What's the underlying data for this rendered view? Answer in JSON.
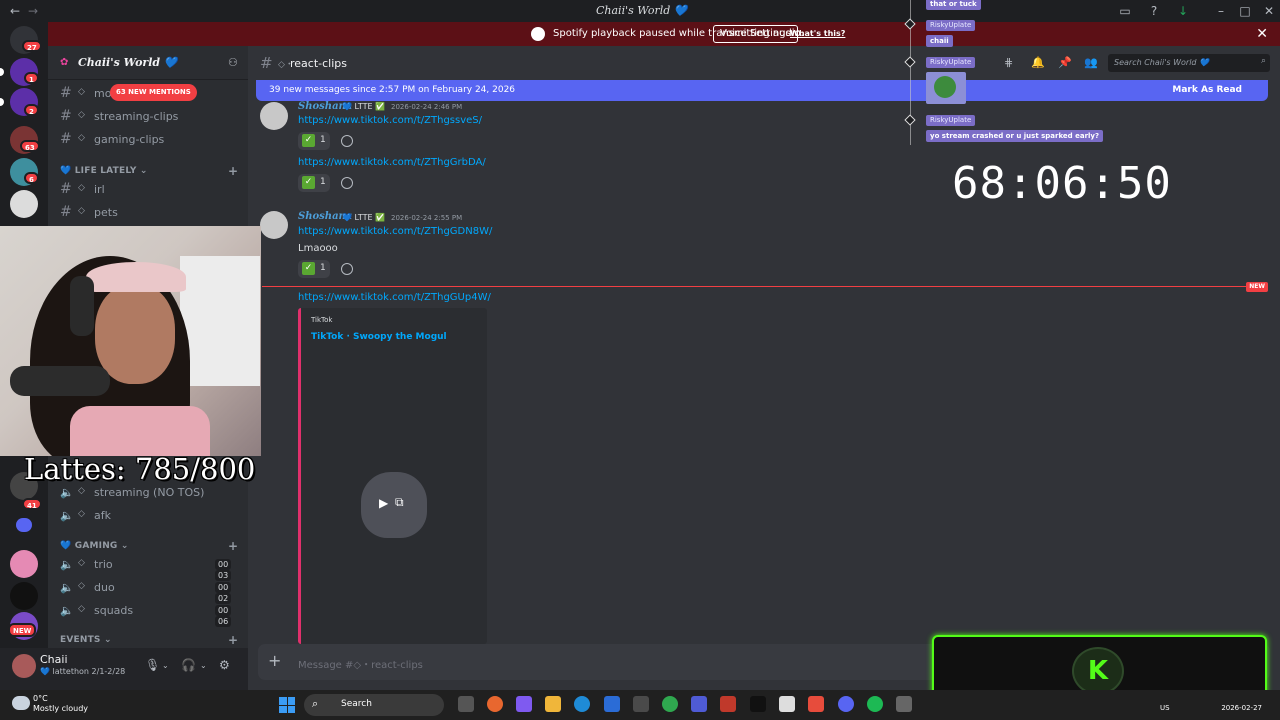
{
  "window": {
    "title": "Chaii's World 💙"
  },
  "banner": {
    "text": "Spotify playback paused while transmitting audio.",
    "voice_settings": "Voice Settings",
    "whats_this": "What's this?"
  },
  "rail": {
    "home_badge": "27",
    "badges": [
      "1",
      "2",
      "63",
      "6",
      "41"
    ],
    "new_label": "NEW"
  },
  "sidebar": {
    "server_name": "Chaii's World 💙",
    "mentions": "63 NEW MENTIONS",
    "channels_top": [
      "mo",
      "streaming-clips",
      "gaming-clips"
    ],
    "cat_life": "💙 LIFE LATELY ⌄",
    "channels_life": [
      "irl",
      "pets"
    ],
    "voice_top": [
      "streaming (NO TOS)",
      "afk"
    ],
    "cat_gaming": "💙 GAMING ⌄",
    "voice_gaming": [
      {
        "name": "trio",
        "a": "00",
        "b": "03"
      },
      {
        "name": "duo",
        "a": "00",
        "b": "02"
      },
      {
        "name": "squads",
        "a": "00",
        "b": "06"
      }
    ],
    "cat_events": "EVENTS ⌄"
  },
  "user": {
    "name": "Chaii",
    "status": "💙 lattethon 2/1-2/28"
  },
  "channel": {
    "name": "react-clips",
    "new_messages": "39 new messages since 2:57 PM on February 24, 2026",
    "mark_read": "Mark As Read",
    "search_placeholder": "Search Chaii's World 💙",
    "composer_placeholder": "Message #◇・react-clips"
  },
  "messages": [
    {
      "author": "Shoshana",
      "tag": "LTTE",
      "time": "2026-02-24 2:46 PM",
      "link1": "https://www.tiktok.com/t/ZThgssveS/",
      "react1": "1",
      "link2": "https://www.tiktok.com/t/ZThgGrbDA/",
      "react2": "1"
    },
    {
      "author": "Shoshana",
      "tag": "LTTE",
      "time": "2026-02-24 2:55 PM",
      "link1": "https://www.tiktok.com/t/ZThgGDN8W/",
      "text": "Lmaooo",
      "react1": "1"
    }
  ],
  "new_link": "https://www.tiktok.com/t/ZThgGUp4W/",
  "new_label": "NEW",
  "embed": {
    "provider": "TikTok",
    "title": "TikTok · Swoopy the Mogul"
  },
  "overlay": {
    "msg_top": "that or tuck",
    "user1": "RiskyUplate",
    "chip1": "chaii",
    "user2": "RiskyUplate",
    "user3": "RiskyUplate",
    "chip3": "yo stream crashed or u just sparked early?",
    "timer": "68:06:50",
    "lattes": "Lattes: 785/800"
  },
  "taskbar": {
    "temp": "0°C",
    "condition": "Mostly cloudy",
    "search": "Search",
    "lang": "US",
    "date": "2026-02-27"
  },
  "colors": {
    "blurple": "#5865f2",
    "red": "#f23f43",
    "kick": "#53fc18",
    "banner": "#5c1016"
  }
}
